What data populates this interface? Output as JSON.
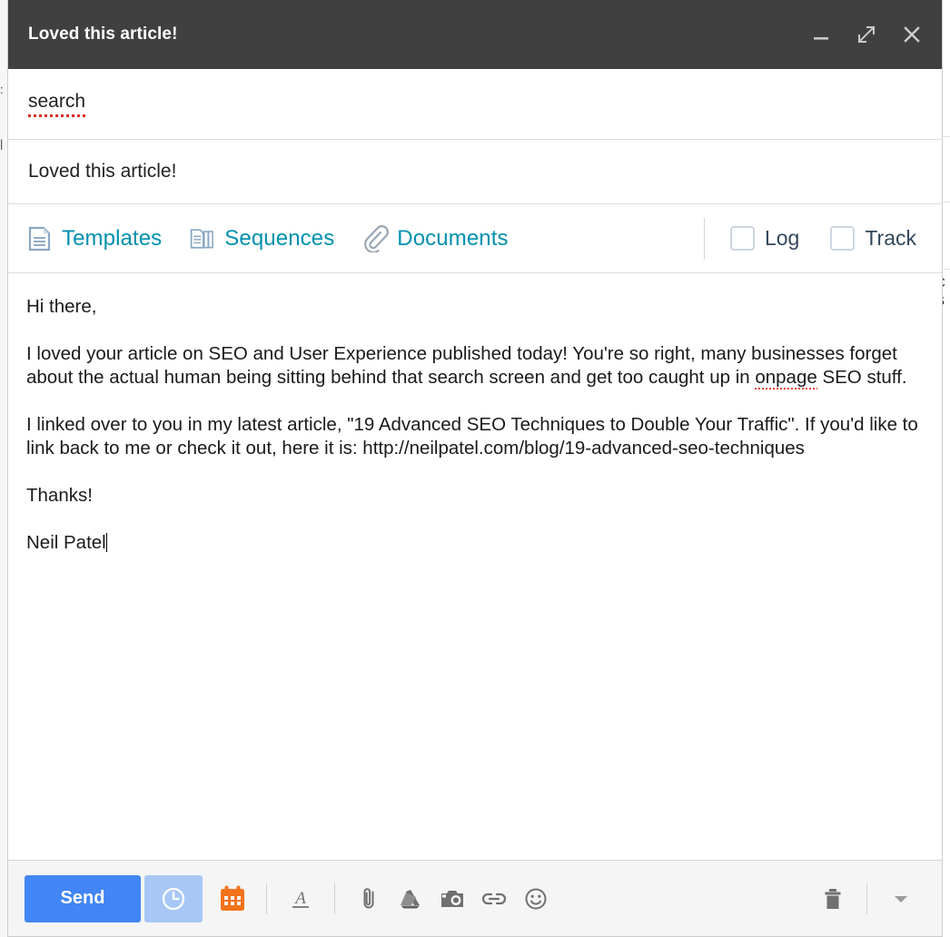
{
  "window": {
    "title": "Loved this article!",
    "controls": [
      {
        "name": "minimize",
        "label": "_"
      },
      {
        "name": "expand",
        "label": "↗"
      },
      {
        "name": "close",
        "label": "✕"
      }
    ]
  },
  "recipient": {
    "value": "search",
    "misspelled": true
  },
  "subject": {
    "value": "Loved this article!"
  },
  "hubspot_toolbar": {
    "items": [
      {
        "label": "Templates",
        "icon": "document-icon"
      },
      {
        "label": "Sequences",
        "icon": "documents-stack-icon"
      },
      {
        "label": "Documents",
        "icon": "paperclip-icon"
      }
    ],
    "checkboxes": [
      {
        "label": "Log",
        "checked": false
      },
      {
        "label": "Track",
        "checked": false
      }
    ]
  },
  "body": {
    "paragraphs": [
      {
        "text": "Hi there,"
      },
      {
        "text_before": "I loved your article on SEO and User Experience published today! You're so right, many businesses forget about the actual human being sitting behind that search screen and get too caught up in ",
        "misspelled_word": "onpage",
        "text_after": " SEO stuff."
      },
      {
        "text": "I linked over to you in my latest article, \"19 Advanced SEO Techniques to Double Your Traffic\". If you'd like to link back to me or check it out, here it is: http://neilpatel.com/blog/19-advanced-seo-techniques"
      },
      {
        "text": "Thanks!"
      },
      {
        "text": "Neil Patel",
        "has_caret": true
      }
    ]
  },
  "footer": {
    "send_label": "Send",
    "schedule_icon": "clock-icon",
    "icons": [
      {
        "name": "calendar-icon",
        "color": "#f2731c"
      },
      {
        "name": "format-text-icon",
        "color": "#707070"
      },
      {
        "name": "attach-file-icon",
        "color": "#707070"
      },
      {
        "name": "google-drive-icon",
        "color": "#707070"
      },
      {
        "name": "insert-photo-icon",
        "color": "#707070"
      },
      {
        "name": "insert-link-icon",
        "color": "#707070"
      },
      {
        "name": "insert-emoji-icon",
        "color": "#707070"
      },
      {
        "name": "discard-draft-icon",
        "color": "#707070"
      },
      {
        "name": "more-options-icon",
        "color": "#9a9a9a"
      }
    ]
  },
  "background": {
    "right_edge_fragments": [
      "C",
      "S"
    ]
  },
  "colors": {
    "header_bg": "#404040",
    "accent_link": "#0091ae",
    "send_blue": "#4285f4",
    "schedule_blue": "#a8c7f7",
    "calendar_orange": "#f2731c",
    "spellcheck_red": "#d93025",
    "checkbox_border": "#cdd6e0",
    "checkbox_label": "#33475b"
  }
}
